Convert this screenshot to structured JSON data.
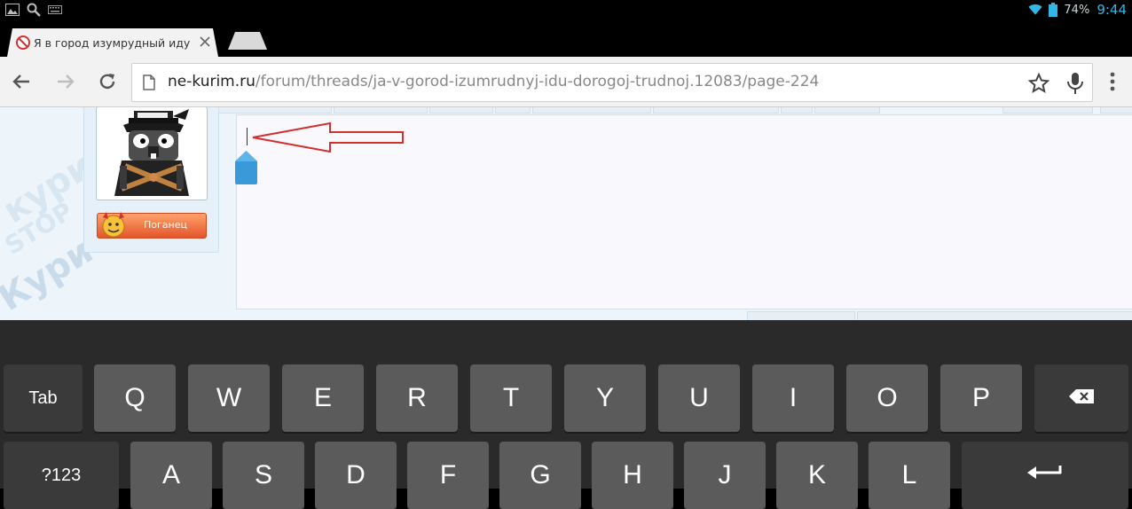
{
  "status_bar": {
    "battery_percent": "74%",
    "time": "9:44",
    "accent_color": "#33b5e5",
    "icons": [
      "gallery-icon",
      "search-icon",
      "keyboard-icon",
      "wifi-icon",
      "battery-icon"
    ]
  },
  "tabs": [
    {
      "title": "Я в город изумрудный иду",
      "active": true,
      "favicon": "no-entry-favicon-icon"
    }
  ],
  "toolbar": {
    "url_host": "ne-kurim.ru",
    "url_path": "/forum/threads/ja-v-gorod-izumrudnyj-idu-dorogoj-trudnoj.12083/page-224",
    "icons": [
      "back-arrow-icon",
      "forward-arrow-icon",
      "reload-icon",
      "page-icon",
      "star-icon",
      "mic-icon",
      "overflow-menu-icon"
    ]
  },
  "page": {
    "user_rank": "Поганец",
    "watermark": [
      "STOP",
      "Кури",
      "кури.ру"
    ]
  },
  "keyboard": {
    "row1": [
      "Q",
      "W",
      "E",
      "R",
      "T",
      "Y",
      "U",
      "I",
      "O",
      "P"
    ],
    "row2": [
      "A",
      "S",
      "D",
      "F",
      "G",
      "H",
      "J",
      "K",
      "L"
    ],
    "tab_label": "Tab",
    "symbols_label": "?123"
  }
}
